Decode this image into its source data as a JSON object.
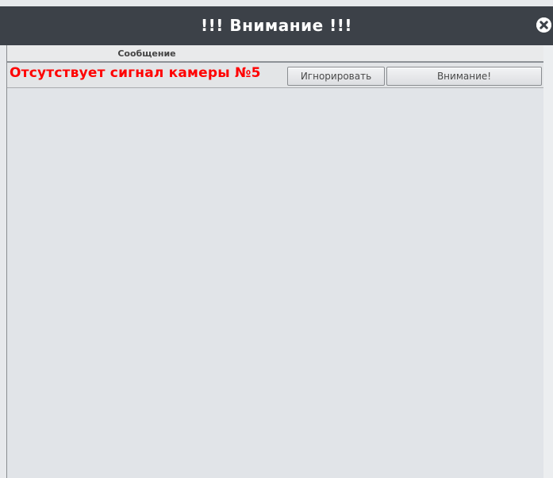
{
  "window": {
    "title": "!!! Внимание !!!"
  },
  "table": {
    "header": "Сообщение",
    "rows": [
      {
        "message": "Отсутствует сигнал камеры №5",
        "ignore_label": "Игнорировать",
        "attention_label": "Внимание!"
      }
    ]
  },
  "icons": {
    "close": "close-icon"
  },
  "colors": {
    "titlebar": "#3c4148",
    "message_text": "#ff0000",
    "background": "#e1e4e8"
  }
}
